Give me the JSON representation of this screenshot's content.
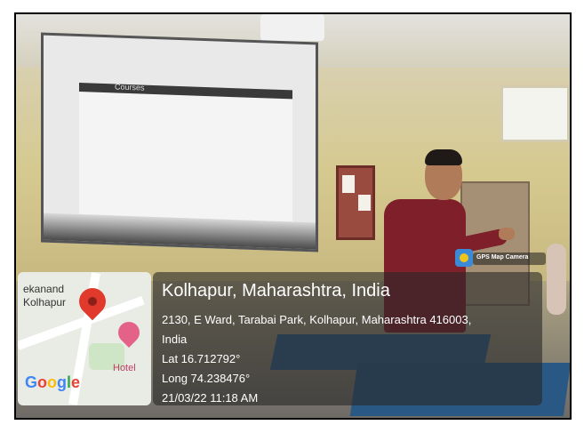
{
  "overlay": {
    "app_badge": "GPS Map Camera",
    "map": {
      "place_text": "ekanand\nKolhapur",
      "poi_label": "Hotel",
      "map_provider": "Google"
    },
    "location": {
      "title": "Kolhapur, Maharashtra, India",
      "address_line1": "2130, E Ward, Tarabai Park, Kolhapur, Maharashtra 416003,",
      "address_line2": "India",
      "latitude": "Lat 16.712792°",
      "longitude": "Long 74.238476°",
      "timestamp": "21/03/22 11:18 AM"
    }
  },
  "projected_screen": {
    "heading": "Courses"
  },
  "colors": {
    "shirt": "#7e1f2a",
    "desk": "#2d5d8b",
    "pin": "#e13a2d",
    "hotel_pin": "#e4628a"
  }
}
